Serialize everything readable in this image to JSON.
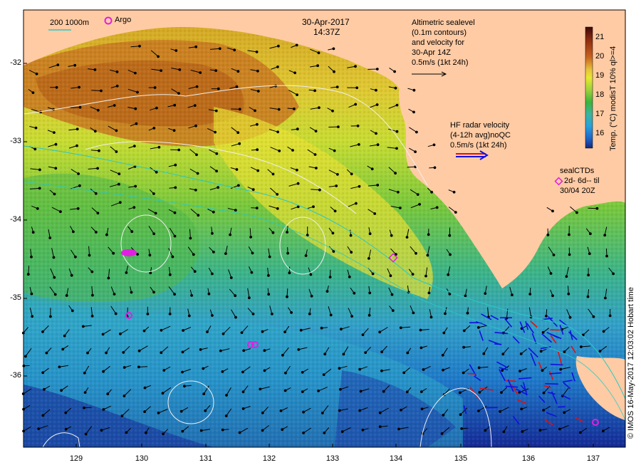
{
  "title": {
    "date": "30-Apr-2017",
    "time": "14:37Z"
  },
  "legend_top_left": {
    "scale_labels": "200  1000m",
    "argo_label": "Argo"
  },
  "altimetry_note": [
    "Altimetric sealevel",
    "(0.1m contours)",
    "and velocity for",
    "30-Apr 14Z",
    "0.5m/s (1kt 24h)"
  ],
  "hf_radar_note": [
    "HF radar velocity",
    "(4-12h avg)noQC",
    "0.5m/s (1kt 24h)"
  ],
  "sealctd_note": [
    "sealCTDs",
    "2d- 6d-- til",
    "30/04 20Z"
  ],
  "colorbar": {
    "ticks": [
      "21",
      "20",
      "19",
      "18",
      "17",
      "16"
    ],
    "title": "Temp. (°C) modisT 10% ql>=4",
    "stops": [
      "#3b0a0a",
      "#8b2a10",
      "#c8641e",
      "#e6c23c",
      "#e8e832",
      "#9cd23c",
      "#3cb43c",
      "#3cb4a0",
      "#28a0dc",
      "#1e64c8",
      "#14287a"
    ]
  },
  "axes": {
    "y_ticks": [
      "-32",
      "-33",
      "-34",
      "-35",
      "-36"
    ],
    "x_ticks": [
      "129",
      "130",
      "131",
      "132",
      "133",
      "134",
      "135",
      "136",
      "137"
    ]
  },
  "credit": "© IMOS 16-May-2017 12:03:02 Hobart time",
  "colors": {
    "land": "#ffcba4",
    "argo": "#e020e0",
    "hf_blue": "#1010e0",
    "hf_red": "#e01010",
    "contour": "#f4f4f4",
    "shelf": "#28c8c8"
  }
}
